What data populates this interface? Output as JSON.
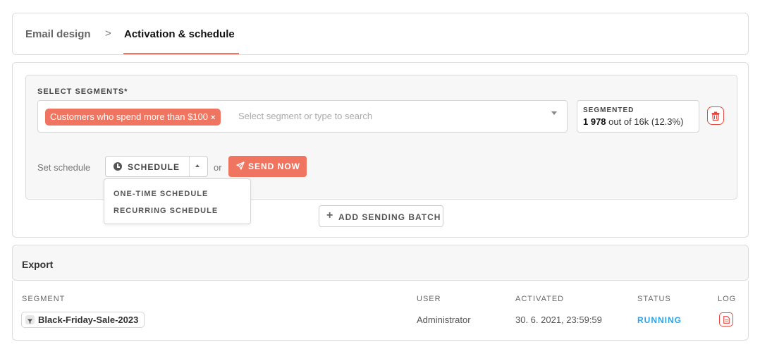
{
  "breadcrumb": {
    "step1": "Email design",
    "separator": ">",
    "step2": "Activation & schedule"
  },
  "activation": {
    "segments_label": "SELECT SEGMENTS*",
    "selected_segment": "Customers who spend more than $100",
    "chip_remove": "×",
    "search_placeholder": "Select segment or type to search",
    "segmented_title": "SEGMENTED",
    "segmented_count": "1 978",
    "segmented_rest": "out of 16k (12.3%)",
    "schedule_label": "Set schedule",
    "schedule_value": "SCHEDULE",
    "or_text": "or",
    "send_now": "SEND NOW",
    "schedule_menu": [
      "ONE-TIME SCHEDULE",
      "RECURRING SCHEDULE"
    ],
    "add_batch": "ADD SENDING BATCH",
    "add_batch_icon": "+"
  },
  "export": {
    "title": "Export",
    "columns": [
      "SEGMENT",
      "USER",
      "ACTIVATED",
      "STATUS",
      "LOG"
    ],
    "rows": [
      {
        "segment": "Black-Friday-Sale-2023",
        "user": "Administrator",
        "activated": "30. 6. 2021, 23:59:59",
        "status": "RUNNING"
      }
    ]
  },
  "colors": {
    "accent": "#ef7561",
    "danger": "#e5483f",
    "running": "#2fa3e6"
  },
  "icons": {
    "breadcrumb_separator": "chevron-right-icon",
    "delete": "trash-icon",
    "schedule": "clock-icon",
    "send": "paper-plane-icon",
    "segment_type": "filter-icon",
    "log": "document-icon"
  }
}
